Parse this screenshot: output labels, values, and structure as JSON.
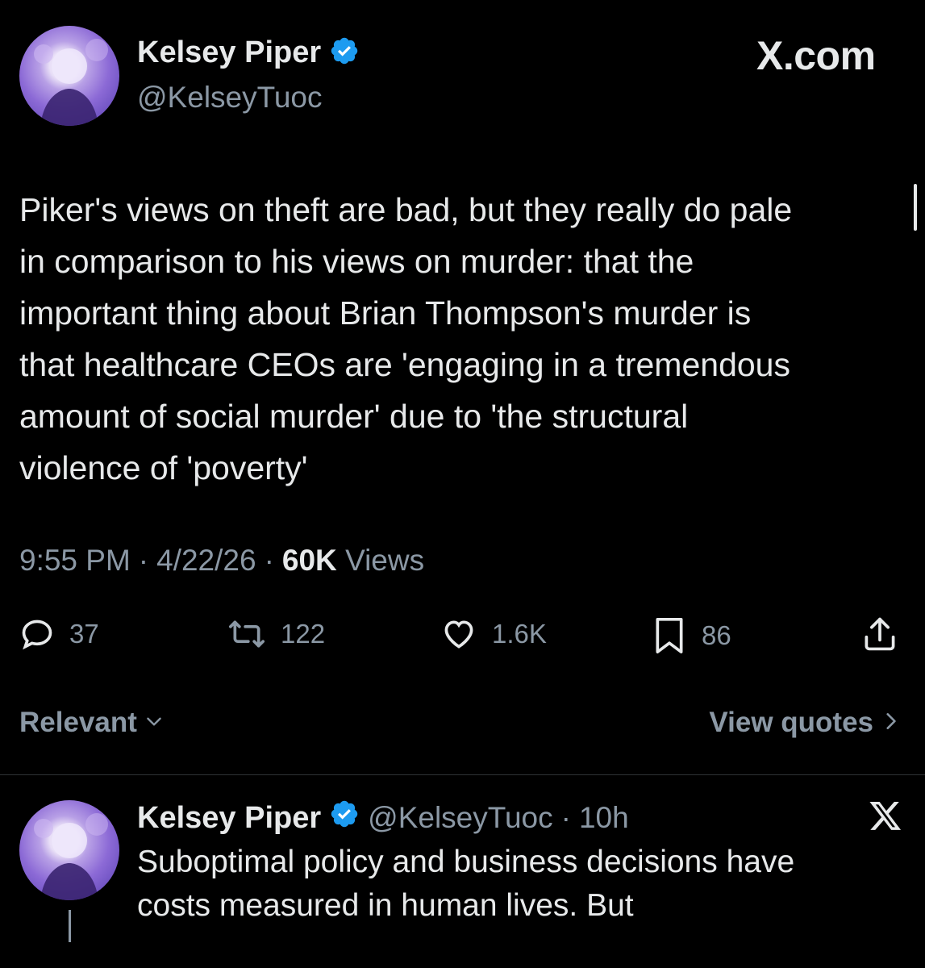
{
  "main_tweet": {
    "author_name": "Kelsey Piper",
    "author_handle": "@KelseyTuoc",
    "site_label": "X.com",
    "text_lines": [
      "Piker's views on theft are bad, but they really do pale",
      "in comparison to his views on murder: that the",
      "important thing about Brian Thompson's murder is",
      "that healthcare CEOs are 'engaging in a tremendous",
      "amount of social murder' due to 'the structural",
      "violence of 'poverty'"
    ],
    "time": "9:55 PM",
    "date": "4/22/26",
    "views_count": "60K",
    "views_label": "Views",
    "separator": "·",
    "actions": {
      "replies": "37",
      "reposts": "122",
      "likes": "1.6K",
      "bookmarks": "86"
    }
  },
  "sort": {
    "label": "Relevant",
    "view_quotes_label": "View quotes"
  },
  "reply_tweet": {
    "author_name": "Kelsey Piper",
    "author_handle": "@KelseyTuoc",
    "separator": "·",
    "age": "10h",
    "text_lines": [
      "Suboptimal policy and business decisions have",
      "costs measured in human lives. But"
    ]
  },
  "icons": {
    "verified": "verified-badge-icon",
    "x_logo": "x-logo-icon",
    "reply": "reply-icon",
    "repost": "repost-icon",
    "like": "heart-icon",
    "bookmark": "bookmark-icon",
    "share": "share-icon",
    "chevron_down": "chevron-down-icon",
    "chevron_right": "chevron-right-icon"
  },
  "colors": {
    "background": "#000000",
    "text": "#e7e9ea",
    "secondary": "#8b98a5",
    "verified": "#1d9bf0",
    "avatar": "#8c6ad6"
  }
}
